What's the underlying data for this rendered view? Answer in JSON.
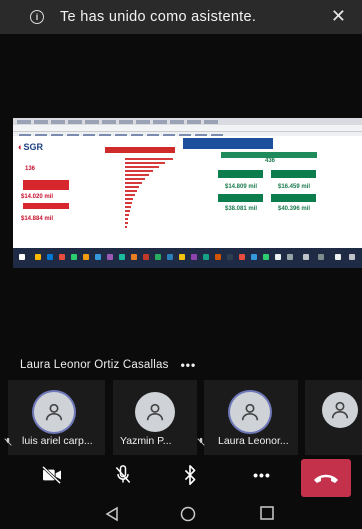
{
  "notification": {
    "message": "Te has unido como asistente.",
    "info_icon": "info-icon",
    "close_icon": "close-icon"
  },
  "shared_screen": {
    "logo": {
      "prefix": "",
      "text": "SGR"
    },
    "kpis_left": [
      "136",
      "$14.020 mil",
      "$14.884 mil"
    ],
    "kpis_right": [
      "436",
      "$14.809 mil",
      "$16.459 mil",
      "$38.081 mil",
      "$40.396 mil"
    ]
  },
  "active_speaker": {
    "name": "Laura Leonor Ortiz Casallas",
    "more_icon": "more-options-icon"
  },
  "participants": [
    {
      "label": "luis ariel carp...",
      "muted": true
    },
    {
      "label": "Yazmin P...",
      "muted": false
    },
    {
      "label": "Laura Leonor...",
      "muted": true
    },
    {
      "label": "",
      "muted": false
    }
  ],
  "controls": {
    "camera_icon": "camera-off-icon",
    "mic_icon": "mic-off-icon",
    "bluetooth_icon": "bluetooth-icon",
    "more_icon": "more-icon",
    "hangup_icon": "hang-up-icon",
    "hangup_color": "#c4314b"
  },
  "android_nav": [
    "back-icon",
    "home-icon",
    "recents-icon"
  ]
}
